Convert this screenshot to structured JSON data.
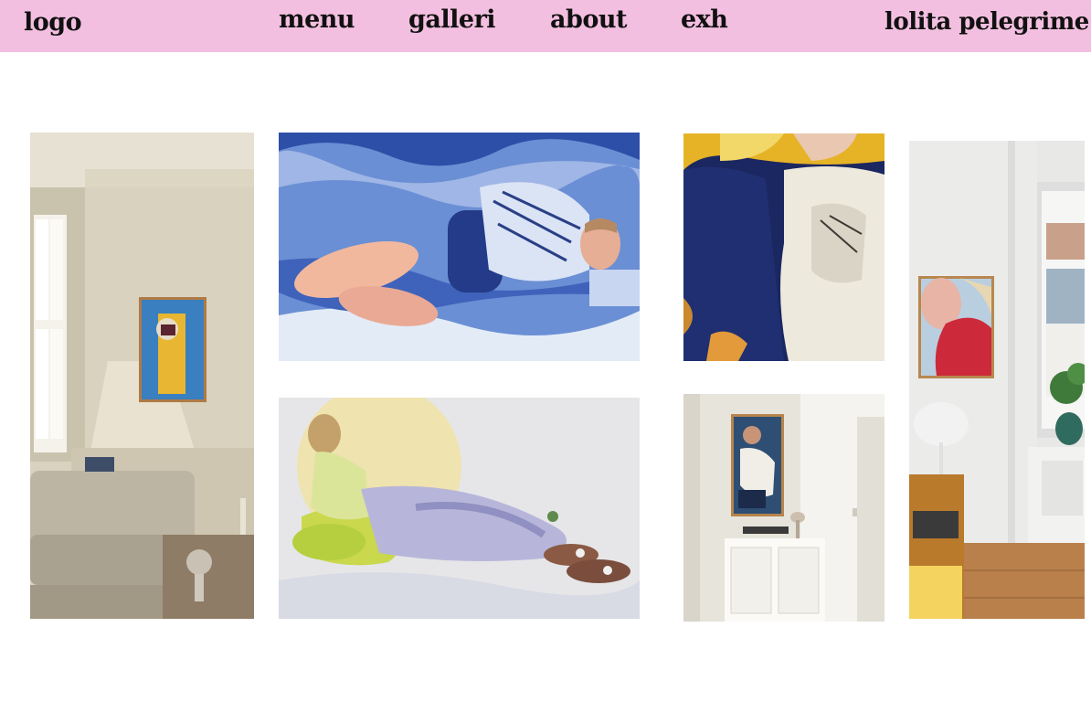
{
  "header": {
    "logo": "logo",
    "nav": [
      "menu",
      "galleri",
      "about",
      "exh"
    ],
    "site_name": "lolita pelegrime",
    "background": "#f3bfe0"
  },
  "gallery": {
    "tiles": [
      {
        "subject": "living-room interior with framed painting on wall"
      },
      {
        "subject": "painting of figure sleeping on blue textured sheets"
      },
      {
        "subject": "painting of reclining figure in pastel clothes on white ground"
      },
      {
        "subject": "close-up painting of figure in dark blue with white shirt"
      },
      {
        "subject": "framed painting above white cabinet in corner"
      },
      {
        "subject": "interior with red-haired portrait, lamp and window"
      }
    ]
  }
}
